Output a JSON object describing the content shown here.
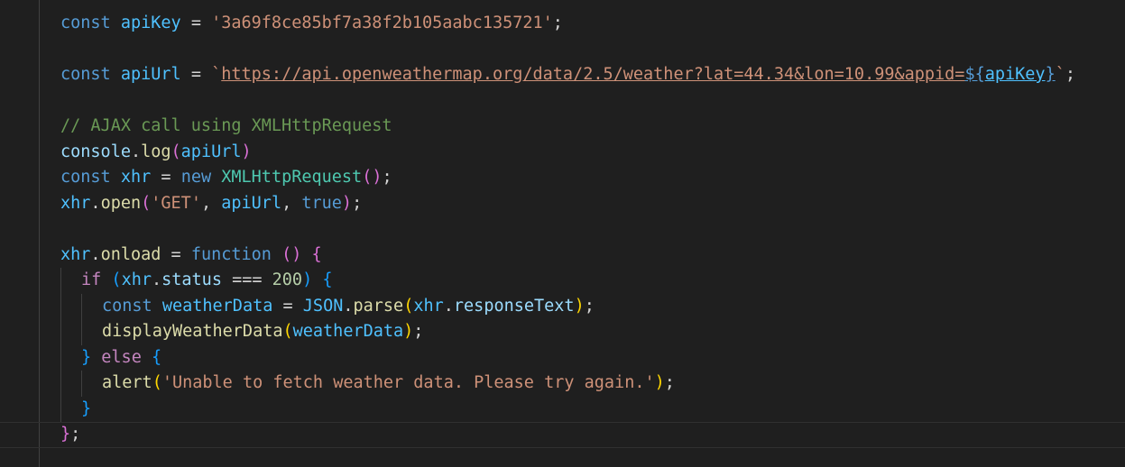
{
  "editor": {
    "line1": {
      "kw": "const",
      "name": "apiKey",
      "op": "=",
      "value": "'3a69f8ce85bf7a38f2b105aabc135721'",
      "end": ";"
    },
    "line3": {
      "kw": "const",
      "name": "apiUrl",
      "op": "=",
      "tick_open": "`",
      "url": "https://api.openweathermap.org/data/2.5/weather?lat=44.34&lon=10.99&appid=",
      "interp_open": "${",
      "interp_var": "apiKey",
      "interp_close": "}",
      "tick_close": "`",
      "end": ";"
    },
    "line5": {
      "comment": "// AJAX call using XMLHttpRequest"
    },
    "line6": {
      "obj": "console",
      "dot": ".",
      "method": "log",
      "open": "(",
      "arg": "apiUrl",
      "close": ")"
    },
    "line7": {
      "kw": "const",
      "name": "xhr",
      "op": "=",
      "new": "new",
      "cls": "XMLHttpRequest",
      "parens": "()",
      "end": ";"
    },
    "line8": {
      "obj": "xhr",
      "dot": ".",
      "method": "open",
      "open": "(",
      "arg1": "'GET'",
      "comma1": ",",
      "arg2": "apiUrl",
      "comma2": ",",
      "arg3": "true",
      "close": ")",
      "end": ";"
    },
    "line10": {
      "obj": "xhr",
      "dot": ".",
      "prop": "onload",
      "op": "=",
      "kw": "function",
      "parens": "()",
      "brace": "{"
    },
    "line11": {
      "kw": "if",
      "open": "(",
      "obj": "xhr",
      "dot": ".",
      "prop": "status",
      "op": "===",
      "num": "200",
      "close": ")",
      "brace": "{"
    },
    "line12": {
      "kw": "const",
      "name": "weatherData",
      "op": "=",
      "cst": "JSON",
      "dot": ".",
      "method": "parse",
      "open": "(",
      "obj": "xhr",
      "dot2": ".",
      "prop": "responseText",
      "close": ")",
      "end": ";"
    },
    "line13": {
      "fn": "displayWeatherData",
      "open": "(",
      "arg": "weatherData",
      "close": ")",
      "end": ";"
    },
    "line14": {
      "brace_close": "}",
      "kw": "else",
      "brace": "{"
    },
    "line15": {
      "fn": "alert",
      "open": "(",
      "str": "'Unable to fetch weather data. Please try again.'",
      "close": ")",
      "end": ";"
    },
    "line16": {
      "brace": "}"
    },
    "line17": {
      "brace": "}",
      "end": ";"
    }
  }
}
